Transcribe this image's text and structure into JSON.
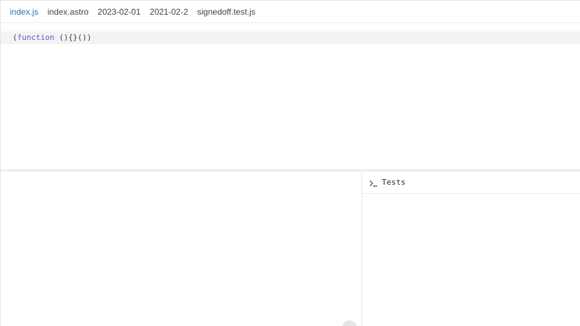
{
  "editor": {
    "tabs": [
      {
        "label": "index.js",
        "active": true
      },
      {
        "label": "index.astro",
        "active": false
      },
      {
        "label": "2023-02-01",
        "active": false
      },
      {
        "label": "2021-02-2",
        "active": false
      },
      {
        "label": "signedoff.test.js",
        "active": false
      }
    ],
    "code": {
      "open": "(",
      "keyword": "function",
      "rest": " (){}())"
    }
  },
  "tests": {
    "title": "Tests",
    "icon": "terminal-icon"
  },
  "colors": {
    "active_tab": "#2f6fb8",
    "keyword": "#7a50c5",
    "line_highlight": "#f3f3f5"
  }
}
